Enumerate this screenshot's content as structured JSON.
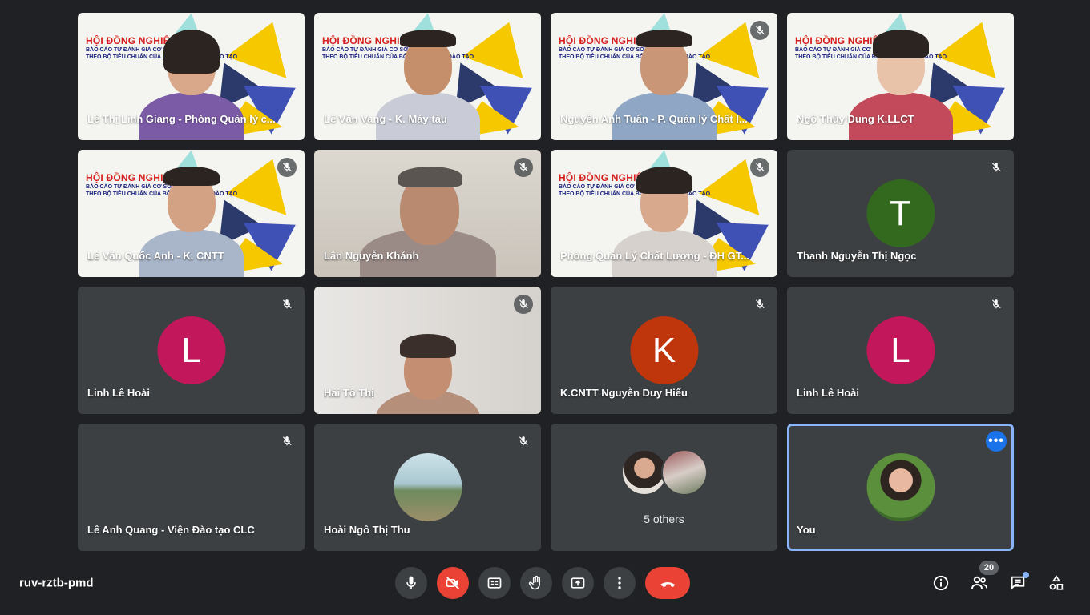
{
  "meeting": {
    "code": "ruv-rztb-pmd",
    "participant_count": "20"
  },
  "banner": {
    "title": "HỘI ĐỒNG NGHIỆM THU",
    "line1": "BÁO CÁO TỰ ĐÁNH GIÁ CƠ SỞ GIÁO DỤC",
    "line2": "THEO BỘ TIÊU CHUẨN CỦA BỘ GIÁO DỤC VÀ ĐÀO TẠO"
  },
  "tiles": [
    {
      "name": "Lê Thị Linh Giang - Phòng Quản lý c..."
    },
    {
      "name": "Lê Văn Vang - K. Máy tàu"
    },
    {
      "name": "Nguyễn Anh Tuấn - P. Quản lý Chất l..."
    },
    {
      "name": "Ngô Thùy Dung K.LLCT"
    },
    {
      "name": "Lê Văn Quốc Anh - K. CNTT"
    },
    {
      "name": "Lân Nguyễn Khánh"
    },
    {
      "name": "Phòng Quản Lý Chất Lượng - ĐH GT..."
    },
    {
      "name": "Thanh Nguyễn Thị Ngọc",
      "initial": "T",
      "color": "#33691e"
    },
    {
      "name": "Linh Lê Hoài",
      "initial": "L",
      "color": "#c2185b"
    },
    {
      "name": "Hải Tô Thị"
    },
    {
      "name": "K.CNTT Nguyễn Duy Hiếu",
      "initial": "K",
      "color": "#bf360c"
    },
    {
      "name": "Linh Lê Hoài",
      "initial": "L",
      "color": "#c2185b"
    },
    {
      "name": "Lê Anh Quang - Viện Đào tạo CLC"
    },
    {
      "name": "Hoài Ngô Thị Thu"
    },
    {
      "others_label": "5 others"
    },
    {
      "name": "You",
      "accent": "#8ab4f8"
    }
  ],
  "icons": {
    "mute": "mic-off-icon",
    "mic": "mic-icon",
    "camera_off": "camera-off-icon",
    "captions": "captions-icon",
    "raise_hand": "hand-icon",
    "present": "present-icon",
    "more": "more-vert-icon",
    "leave": "call-end-icon",
    "info": "info-icon",
    "people": "people-icon",
    "chat": "chat-icon",
    "activities": "activities-icon"
  }
}
